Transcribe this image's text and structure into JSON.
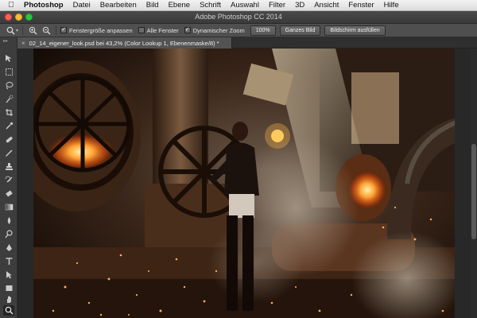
{
  "menubar": {
    "apple_icon": "apple-logo-icon",
    "app_name": "Photoshop",
    "items": [
      "Datei",
      "Bearbeiten",
      "Bild",
      "Ebene",
      "Schrift",
      "Auswahl",
      "Filter",
      "3D",
      "Ansicht",
      "Fenster",
      "Hilfe"
    ]
  },
  "window": {
    "title": "Adobe Photoshop CC 2014"
  },
  "options": {
    "tool_icon": "zoom-icon",
    "zoom_in_icon": "zoom-in-icon",
    "zoom_out_icon": "zoom-out-icon",
    "checkboxes": [
      {
        "label": "Fenstergröße anpassen",
        "checked": true
      },
      {
        "label": "Alle Fenster",
        "checked": false
      },
      {
        "label": "Dynamischer Zoom",
        "checked": true
      }
    ],
    "buttons": [
      "100%",
      "Ganzes Bild",
      "Bildschirm ausfüllen"
    ]
  },
  "document": {
    "tab_title": "02_14_eigener_look.psd bei 43,2% (Color Lookup 1, Ebenenmaske/8) *",
    "close_glyph": "×"
  },
  "colors": {
    "accent_fire": "#ff8a2a",
    "traffic_close": "#ff5f57",
    "traffic_min": "#febc2e",
    "traffic_max": "#28c840"
  }
}
